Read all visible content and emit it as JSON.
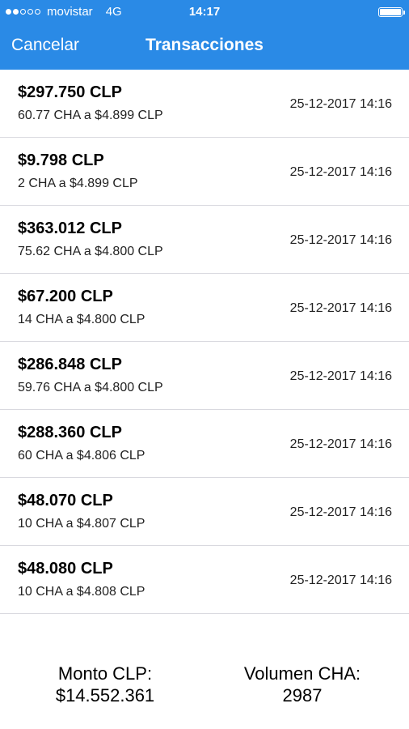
{
  "status_bar": {
    "carrier": "movistar",
    "network": "4G",
    "time": "14:17",
    "signal_bars": 2,
    "signal_total": 5
  },
  "nav": {
    "cancel_label": "Cancelar",
    "title": "Transacciones"
  },
  "transactions": [
    {
      "amount": "$297.750 CLP",
      "detail": "60.77 CHA a $4.899 CLP",
      "date": "25-12-2017 14:16"
    },
    {
      "amount": "$9.798 CLP",
      "detail": "2 CHA a $4.899 CLP",
      "date": "25-12-2017 14:16"
    },
    {
      "amount": "$363.012 CLP",
      "detail": "75.62 CHA a $4.800 CLP",
      "date": "25-12-2017 14:16"
    },
    {
      "amount": "$67.200 CLP",
      "detail": "14 CHA a $4.800 CLP",
      "date": "25-12-2017 14:16"
    },
    {
      "amount": "$286.848 CLP",
      "detail": "59.76 CHA a $4.800 CLP",
      "date": "25-12-2017 14:16"
    },
    {
      "amount": "$288.360 CLP",
      "detail": "60 CHA a $4.806 CLP",
      "date": "25-12-2017 14:16"
    },
    {
      "amount": "$48.070 CLP",
      "detail": "10 CHA a $4.807 CLP",
      "date": "25-12-2017 14:16"
    },
    {
      "amount": "$48.080 CLP",
      "detail": "10 CHA a $4.808 CLP",
      "date": "25-12-2017 14:16"
    }
  ],
  "footer": {
    "monto_label": "Monto CLP:",
    "monto_value": "$14.552.361",
    "volumen_label": "Volumen CHA:",
    "volumen_value": "2987"
  },
  "colors": {
    "accent": "#2a8ae6",
    "divider": "#d9d9df"
  }
}
